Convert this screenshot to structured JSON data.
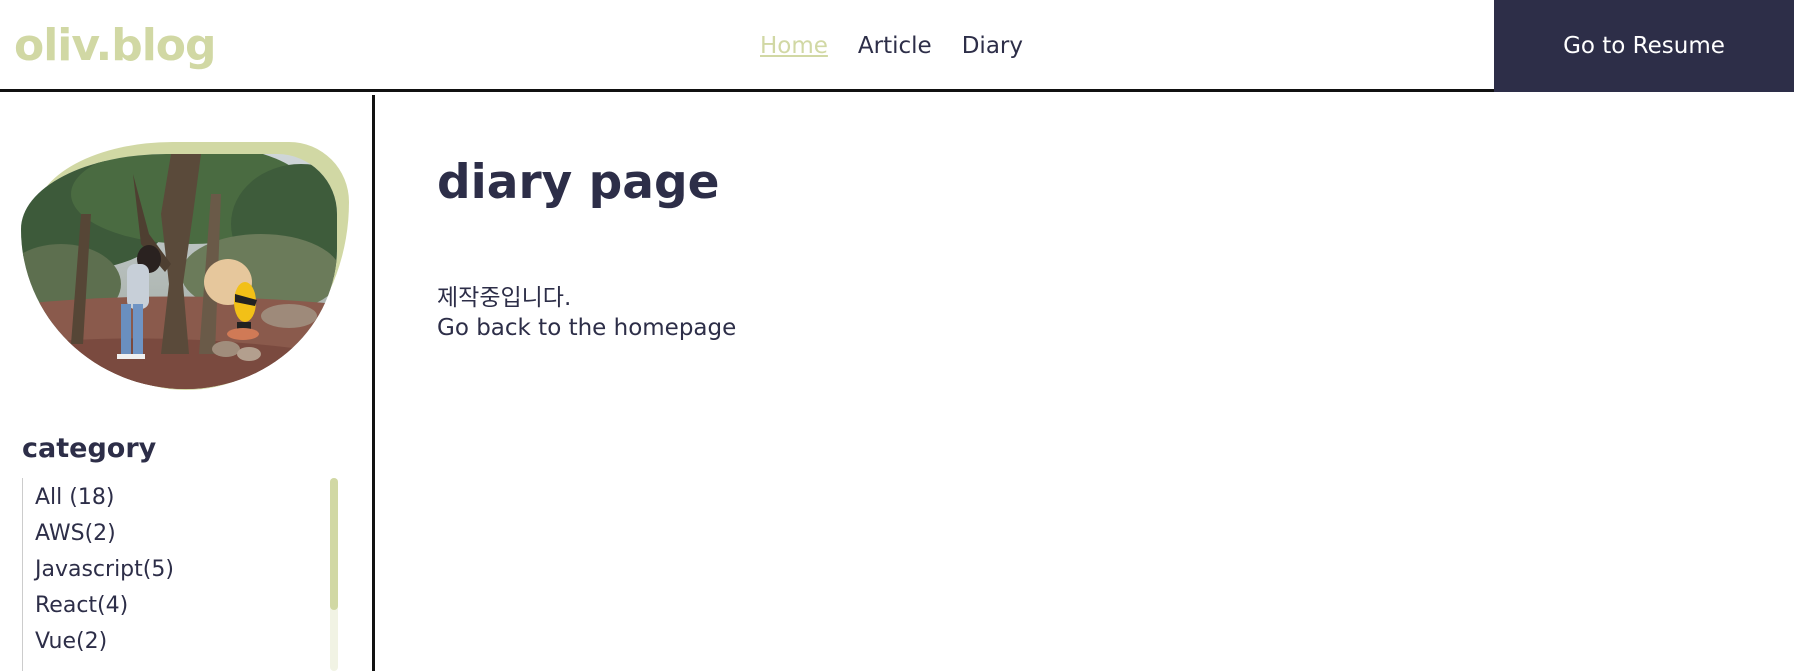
{
  "header": {
    "logo": "oliv.blog",
    "nav": [
      {
        "label": "Home",
        "active": true
      },
      {
        "label": "Article",
        "active": false
      },
      {
        "label": "Diary",
        "active": false
      }
    ],
    "resume_button": "Go to Resume"
  },
  "sidebar": {
    "category_title": "category",
    "categories": [
      "All (18)",
      "AWS(2)",
      "Javascript(5)",
      "React(4)",
      "Vue(2)"
    ]
  },
  "main": {
    "title": "diary page",
    "message": "제작중입니다.",
    "home_link": "Go back to the homepage"
  },
  "colors": {
    "accent": "#d1d8a4",
    "dark": "#2d2e48",
    "border": "#111111"
  }
}
